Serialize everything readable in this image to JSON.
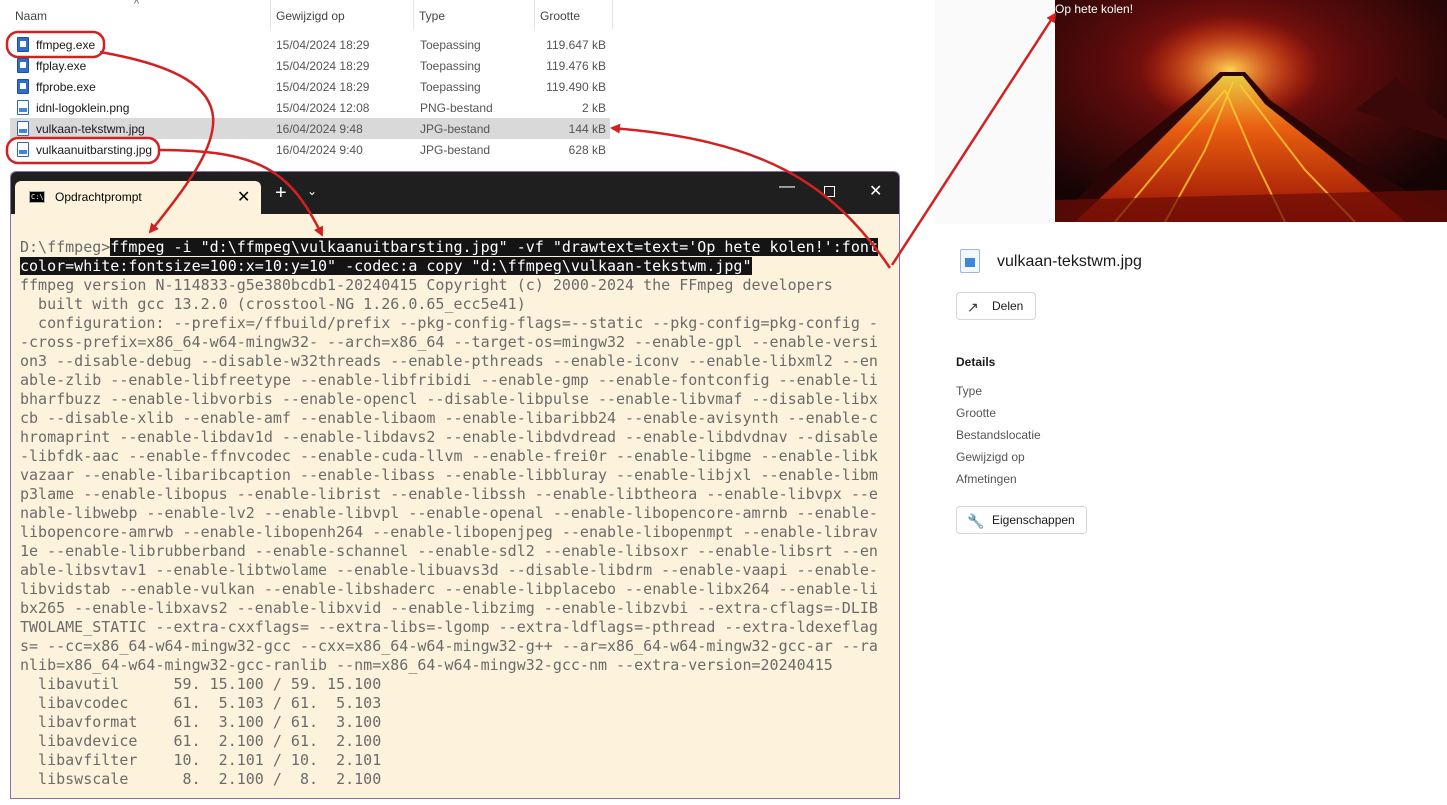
{
  "file_list": {
    "columns": {
      "name": "Naam",
      "modified": "Gewijzigd op",
      "type": "Type",
      "size": "Grootte"
    },
    "rows": [
      {
        "name": "ffmpeg.exe",
        "modified": "15/04/2024 18:29",
        "type": "Toepassing",
        "size": "119.647 kB",
        "icon": "exe-file-icon"
      },
      {
        "name": "ffplay.exe",
        "modified": "15/04/2024 18:29",
        "type": "Toepassing",
        "size": "119.476 kB",
        "icon": "exe-file-icon"
      },
      {
        "name": "ffprobe.exe",
        "modified": "15/04/2024 18:29",
        "type": "Toepassing",
        "size": "119.490 kB",
        "icon": "exe-file-icon"
      },
      {
        "name": "idnl-logoklein.png",
        "modified": "15/04/2024 12:08",
        "type": "PNG-bestand",
        "size": "2 kB",
        "icon": "image-file-icon"
      },
      {
        "name": "vulkaan-tekstwm.jpg",
        "modified": "16/04/2024 9:48",
        "type": "JPG-bestand",
        "size": "144 kB",
        "icon": "image-file-icon"
      },
      {
        "name": "vulkaanuitbarsting.jpg",
        "modified": "16/04/2024 9:40",
        "type": "JPG-bestand",
        "size": "628 kB",
        "icon": "image-file-icon"
      }
    ]
  },
  "terminal": {
    "tab_title": "Opdrachtprompt",
    "prompt": "D:\\ffmpeg>",
    "command_line_1": "ffmpeg -i \"d:\\ffmpeg\\vulkaanuitbarsting.jpg\" -vf \"drawtext=text='Op hete kolen!':font",
    "command_line_2": "color=white:fontsize=100:x=10:y=10\" -codec:a copy \"d:\\ffmpeg\\vulkaan-tekstwm.jpg\"",
    "output_lines": [
      "ffmpeg version N-114833-g5e380bcdb1-20240415 Copyright (c) 2000-2024 the FFmpeg developers",
      "  built with gcc 13.2.0 (crosstool-NG 1.26.0.65_ecc5e41)",
      "  configuration: --prefix=/ffbuild/prefix --pkg-config-flags=--static --pkg-config=pkg-config -",
      "-cross-prefix=x86_64-w64-mingw32- --arch=x86_64 --target-os=mingw32 --enable-gpl --enable-versi",
      "on3 --disable-debug --disable-w32threads --enable-pthreads --enable-iconv --enable-libxml2 --en",
      "able-zlib --enable-libfreetype --enable-libfribidi --enable-gmp --enable-fontconfig --enable-li",
      "bharfbuzz --enable-libvorbis --enable-opencl --disable-libpulse --enable-libvmaf --disable-libx",
      "cb --disable-xlib --enable-amf --enable-libaom --enable-libaribb24 --enable-avisynth --enable-c",
      "hromaprint --enable-libdav1d --enable-libdavs2 --enable-libdvdread --enable-libdvdnav --disable",
      "-libfdk-aac --enable-ffnvcodec --enable-cuda-llvm --enable-frei0r --enable-libgme --enable-libk",
      "vazaar --enable-libaribcaption --enable-libass --enable-libbluray --enable-libjxl --enable-libm",
      "p3lame --enable-libopus --enable-librist --enable-libssh --enable-libtheora --enable-libvpx --e",
      "nable-libwebp --enable-lv2 --enable-libvpl --enable-openal --enable-libopencore-amrnb --enable-",
      "libopencore-amrwb --enable-libopenh264 --enable-libopenjpeg --enable-libopenmpt --enable-librav",
      "1e --enable-librubberband --enable-schannel --enable-sdl2 --enable-libsoxr --enable-libsrt --en",
      "able-libsvtav1 --enable-libtwolame --enable-libuavs3d --disable-libdrm --enable-vaapi --enable-",
      "libvidstab --enable-vulkan --enable-libshaderc --enable-libplacebo --enable-libx264 --enable-li",
      "bx265 --enable-libxavs2 --enable-libxvid --enable-libzimg --enable-libzvbi --extra-cflags=-DLIB",
      "TWOLAME_STATIC --extra-cxxflags= --extra-libs=-lgomp --extra-ldflags=-pthread --extra-ldexeflag",
      "s= --cc=x86_64-w64-mingw32-gcc --cxx=x86_64-w64-mingw32-g++ --ar=x86_64-w64-mingw32-gcc-ar --ra",
      "nlib=x86_64-w64-mingw32-gcc-ranlib --nm=x86_64-w64-mingw32-gcc-nm --extra-version=20240415",
      "  libavutil      59. 15.100 / 59. 15.100",
      "  libavcodec     61.  5.103 / 61.  5.103",
      "  libavformat    61.  3.100 / 61.  3.100",
      "  libavdevice    61.  2.100 / 61.  2.100",
      "  libavfilter    10.  2.101 / 10.  2.101",
      "  libswscale      8.  2.100 /  8.  2.100"
    ]
  },
  "details_pane": {
    "image_overlay_text": "Op hete kolen!",
    "file_title": "vulkaan-tekstwm.jpg",
    "share_label": "Delen",
    "details_heading": "Details",
    "detail_labels": [
      "Type",
      "Grootte",
      "Bestandslocatie",
      "Gewijzigd op",
      "Afmetingen"
    ],
    "properties_label": "Eigenschappen"
  },
  "colors": {
    "terminal_background": "#fdf3dc",
    "terminal_titlebar": "#1f1f1f",
    "annotation_red": "#d42020",
    "selected_row": "#d9d9d9"
  }
}
